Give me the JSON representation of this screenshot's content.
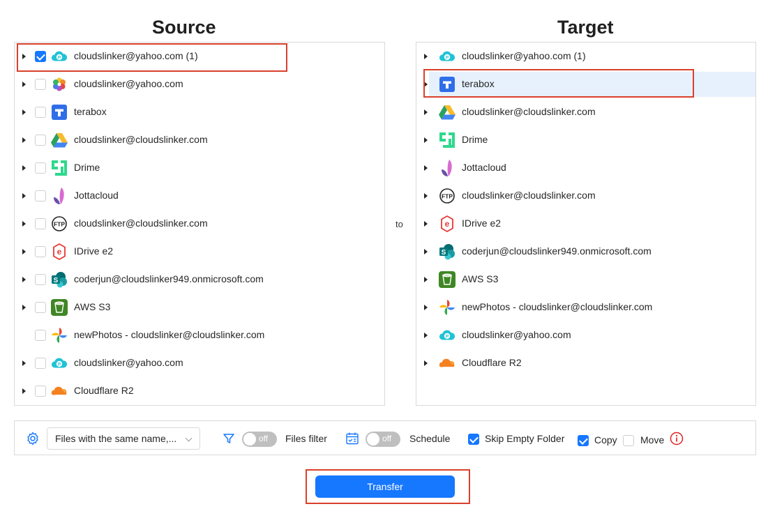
{
  "source": {
    "title": "Source",
    "items": [
      {
        "label": "cloudslinker@yahoo.com (1)",
        "icon": "pcloud-icon",
        "checked": true,
        "expandable": true
      },
      {
        "label": "cloudslinker@yahoo.com",
        "icon": "photos-flower-icon",
        "checked": false,
        "expandable": true
      },
      {
        "label": "terabox",
        "icon": "terabox-icon",
        "checked": false,
        "expandable": true
      },
      {
        "label": "cloudslinker@cloudslinker.com",
        "icon": "google-drive-icon",
        "checked": false,
        "expandable": true
      },
      {
        "label": "Drime",
        "icon": "drime-icon",
        "checked": false,
        "expandable": true
      },
      {
        "label": "Jottacloud",
        "icon": "jottacloud-icon",
        "checked": false,
        "expandable": true
      },
      {
        "label": "cloudslinker@cloudslinker.com",
        "icon": "ftp-icon",
        "checked": false,
        "expandable": true
      },
      {
        "label": "IDrive e2",
        "icon": "idrive-e2-icon",
        "checked": false,
        "expandable": true
      },
      {
        "label": "coderjun@cloudslinker949.onmicrosoft.com",
        "icon": "sharepoint-icon",
        "checked": false,
        "expandable": true
      },
      {
        "label": "AWS S3",
        "icon": "aws-s3-icon",
        "checked": false,
        "expandable": true
      },
      {
        "label": "newPhotos - cloudslinker@cloudslinker.com",
        "icon": "google-photos-icon",
        "checked": false,
        "expandable": false
      },
      {
        "label": "cloudslinker@yahoo.com",
        "icon": "pcloud-icon",
        "checked": false,
        "expandable": true
      },
      {
        "label": "Cloudflare R2",
        "icon": "cloudflare-icon",
        "checked": false,
        "expandable": true
      }
    ]
  },
  "target": {
    "title": "Target",
    "selected_index": 1,
    "items": [
      {
        "label": "cloudslinker@yahoo.com (1)",
        "icon": "pcloud-icon"
      },
      {
        "label": "terabox",
        "icon": "terabox-icon"
      },
      {
        "label": "cloudslinker@cloudslinker.com",
        "icon": "google-drive-icon"
      },
      {
        "label": "Drime",
        "icon": "drime-icon"
      },
      {
        "label": "Jottacloud",
        "icon": "jottacloud-icon"
      },
      {
        "label": "cloudslinker@cloudslinker.com",
        "icon": "ftp-icon"
      },
      {
        "label": "IDrive e2",
        "icon": "idrive-e2-icon"
      },
      {
        "label": "coderjun@cloudslinker949.onmicrosoft.com",
        "icon": "sharepoint-icon"
      },
      {
        "label": "AWS S3",
        "icon": "aws-s3-icon"
      },
      {
        "label": "newPhotos - cloudslinker@cloudslinker.com",
        "icon": "google-photos-icon"
      },
      {
        "label": "cloudslinker@yahoo.com",
        "icon": "pcloud-icon"
      },
      {
        "label": "Cloudflare R2",
        "icon": "cloudflare-icon"
      }
    ]
  },
  "to_label": "to",
  "options": {
    "conflict_select": "Files with the same name,...",
    "files_filter": {
      "label": "Files filter",
      "state": "off"
    },
    "schedule": {
      "label": "Schedule",
      "state": "off"
    },
    "skip_empty_folder": {
      "label": "Skip Empty Folder",
      "checked": true
    },
    "copy": {
      "label": "Copy",
      "checked": true
    },
    "move": {
      "label": "Move",
      "checked": false
    }
  },
  "transfer_button": "Transfer",
  "colors": {
    "accent": "#1677ff",
    "highlight": "#d9402b",
    "selected_row": "#e6f1fd"
  }
}
